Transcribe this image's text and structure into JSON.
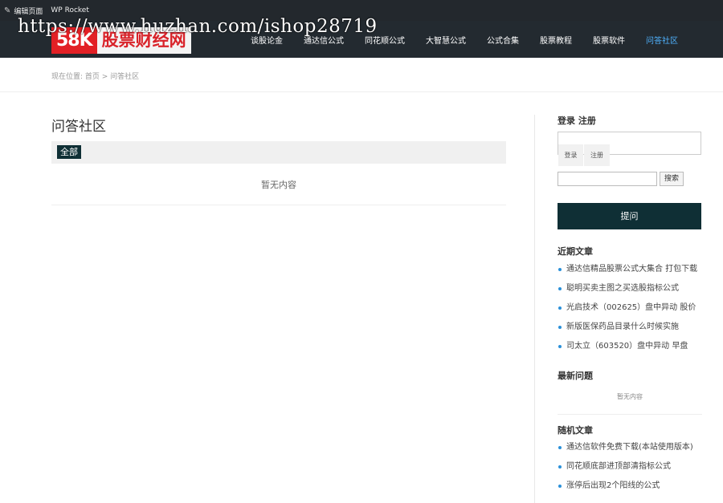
{
  "adminbar": {
    "edit_page": "编辑页面",
    "wp_rocket": "WP Rocket"
  },
  "logo": {
    "mark": "58K",
    "name": "股票财经网"
  },
  "watermark": "https://www.huzhan.com/ishop28719",
  "nav": {
    "items": [
      {
        "label": "谈股论金"
      },
      {
        "label": "通达信公式"
      },
      {
        "label": "同花顺公式"
      },
      {
        "label": "大智慧公式"
      },
      {
        "label": "公式合集"
      },
      {
        "label": "股票教程"
      },
      {
        "label": "股票软件"
      },
      {
        "label": "问答社区"
      }
    ],
    "active_index": 7
  },
  "breadcrumb": "现在位置: 首页 > 问答社区",
  "main": {
    "title": "问答社区",
    "filter_tag": "全部",
    "empty": "暂无内容"
  },
  "sidebar": {
    "login_title": "登录 注册",
    "login_tab": "登录",
    "register_tab": "注册",
    "search_button": "搜索",
    "ask_button": "提问",
    "recent_title": "近期文章",
    "recent_items": [
      "通达信精品股票公式大集合 打包下载",
      "聪明买卖主图之买选股指标公式",
      "光启技术（002625）盘中异动 股价",
      "新版医保药品目录什么时候实施",
      "司太立（603520）盘中异动 早盘"
    ],
    "latest_q_title": "最新问题",
    "latest_q_empty": "暂无内容",
    "random_title": "随机文章",
    "random_items": [
      "通达信软件免费下载(本站使用版本)",
      "同花顺底部进顶部清指标公式",
      "涨停后出现2个阳线的公式"
    ]
  },
  "colors": {
    "admin_bar": "#23282d",
    "header": "#232a30",
    "accent_dark": "#0f2f35",
    "nav_active": "#4fb3ff",
    "logo_red": "#e22025"
  }
}
